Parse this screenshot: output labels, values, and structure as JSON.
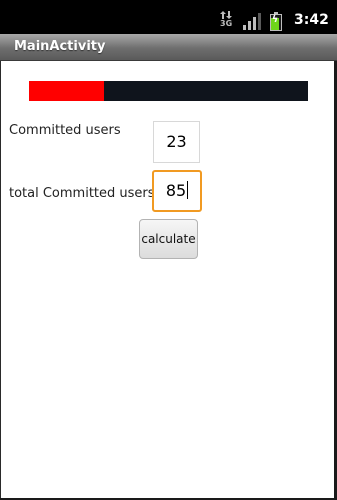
{
  "status_bar": {
    "network_type": "3G",
    "time": "3:42",
    "icons": [
      "3g-data-icon",
      "signal-strength-icon",
      "battery-charging-icon"
    ],
    "battery_color": "#6fd41a"
  },
  "app": {
    "title": "MainActivity"
  },
  "progress": {
    "fraction": 0.27,
    "fill_color": "#ff0000",
    "track_color": "#0f141c"
  },
  "form": {
    "committed_label": "Committed users",
    "committed_value": "23",
    "total_label": "total Committed users",
    "total_value": "85",
    "focus_color": "#f19a22"
  },
  "actions": {
    "calculate_label": "calculate"
  }
}
